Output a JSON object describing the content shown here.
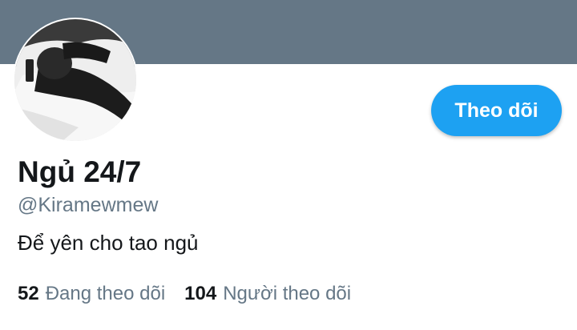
{
  "colors": {
    "banner": "#657786",
    "accent": "#1da1f2",
    "text_primary": "#14171a",
    "text_secondary": "#657786"
  },
  "profile": {
    "display_name": "Ngủ 24/7",
    "handle": "@Kiramewmew",
    "bio": "Để yên cho tao ngủ",
    "follow_button_label": "Theo dõi"
  },
  "stats": {
    "following_count": "52",
    "following_label": "Đang theo dõi",
    "followers_count": "104",
    "followers_label": "Người theo dõi"
  }
}
